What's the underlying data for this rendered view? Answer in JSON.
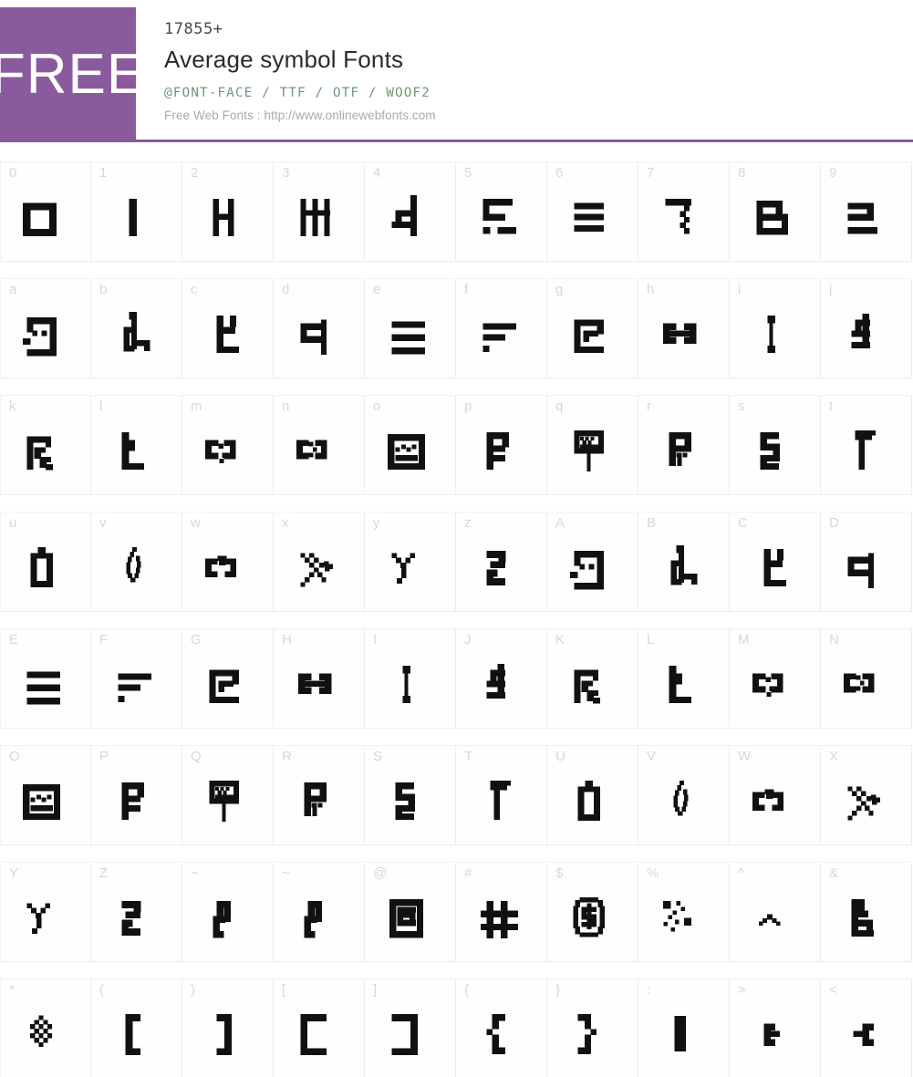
{
  "header": {
    "badge_label": "FREE",
    "count": "17855+",
    "title": "Average symbol Fonts",
    "formats": "@FONT-FACE / TTF / OTF / WOOF2",
    "source": "Free Web Fonts : http://www.onlinewebfonts.com",
    "accent_color": "#8a5a9e",
    "formats_color": "#6f9a7a"
  },
  "grid": {
    "columns": 10,
    "rows": [
      {
        "cells": [
          {
            "label": "0",
            "glyph": "square-outline"
          },
          {
            "label": "1",
            "glyph": "vertical-bar"
          },
          {
            "label": "2",
            "glyph": "h-shape"
          },
          {
            "label": "3",
            "glyph": "triple-bar-h"
          },
          {
            "label": "4",
            "glyph": "hook-right"
          },
          {
            "label": "5",
            "glyph": "s-bars"
          },
          {
            "label": "6",
            "glyph": "three-bars"
          },
          {
            "label": "7",
            "glyph": "seven-dotted"
          },
          {
            "label": "8",
            "glyph": "stacked-boxes"
          },
          {
            "label": "9",
            "glyph": "two-bar-hook"
          }
        ]
      },
      {
        "cells": [
          {
            "label": "a",
            "glyph": "face-box"
          },
          {
            "label": "b",
            "glyph": "giraffe"
          },
          {
            "label": "c",
            "glyph": "chair"
          },
          {
            "label": "d",
            "glyph": "flag-left"
          },
          {
            "label": "e",
            "glyph": "equals-three"
          },
          {
            "label": "f",
            "glyph": "two-bars-dot"
          },
          {
            "label": "g",
            "glyph": "spiral-box"
          },
          {
            "label": "h",
            "glyph": "dumbbell"
          },
          {
            "label": "i",
            "glyph": "i-bar-dots"
          },
          {
            "label": "j",
            "glyph": "flag-post"
          }
        ]
      },
      {
        "cells": [
          {
            "label": "k",
            "glyph": "stairs-flag"
          },
          {
            "label": "l",
            "glyph": "boot"
          },
          {
            "label": "m",
            "glyph": "two-boxes-v"
          },
          {
            "label": "n",
            "glyph": "two-boxes-dots"
          },
          {
            "label": "o",
            "glyph": "robot-face"
          },
          {
            "label": "p",
            "glyph": "flag-bars"
          },
          {
            "label": "q",
            "glyph": "sign-post"
          },
          {
            "label": "r",
            "glyph": "flag-drip"
          },
          {
            "label": "s",
            "glyph": "s-zigzag"
          },
          {
            "label": "t",
            "glyph": "pennant"
          }
        ]
      },
      {
        "cells": [
          {
            "label": "u",
            "glyph": "cup"
          },
          {
            "label": "v",
            "glyph": "leaf"
          },
          {
            "label": "w",
            "glyph": "two-boxes-peak"
          },
          {
            "label": "x",
            "glyph": "cross-scatter"
          },
          {
            "label": "y",
            "glyph": "y-branch"
          },
          {
            "label": "z",
            "glyph": "z-block"
          },
          {
            "label": "A",
            "glyph": "face-box"
          },
          {
            "label": "B",
            "glyph": "giraffe"
          },
          {
            "label": "C",
            "glyph": "chair"
          },
          {
            "label": "D",
            "glyph": "flag-left"
          }
        ]
      },
      {
        "cells": [
          {
            "label": "E",
            "glyph": "equals-three"
          },
          {
            "label": "F",
            "glyph": "two-bars-dot"
          },
          {
            "label": "G",
            "glyph": "spiral-box"
          },
          {
            "label": "H",
            "glyph": "dumbbell"
          },
          {
            "label": "I",
            "glyph": "i-bar-dots"
          },
          {
            "label": "J",
            "glyph": "flag-post"
          },
          {
            "label": "K",
            "glyph": "stairs-flag"
          },
          {
            "label": "L",
            "glyph": "boot"
          },
          {
            "label": "M",
            "glyph": "two-boxes-v"
          },
          {
            "label": "N",
            "glyph": "two-boxes-dots"
          }
        ]
      },
      {
        "cells": [
          {
            "label": "O",
            "glyph": "robot-face"
          },
          {
            "label": "P",
            "glyph": "flag-bars"
          },
          {
            "label": "Q",
            "glyph": "sign-post"
          },
          {
            "label": "R",
            "glyph": "flag-drip"
          },
          {
            "label": "S",
            "glyph": "s-zigzag"
          },
          {
            "label": "T",
            "glyph": "pennant"
          },
          {
            "label": "U",
            "glyph": "cup"
          },
          {
            "label": "V",
            "glyph": "leaf"
          },
          {
            "label": "W",
            "glyph": "two-boxes-peak"
          },
          {
            "label": "X",
            "glyph": "cross-scatter"
          }
        ]
      },
      {
        "cells": [
          {
            "label": "Y",
            "glyph": "y-branch"
          },
          {
            "label": "Z",
            "glyph": "z-block"
          },
          {
            "label": "~",
            "glyph": "zigzag-hook"
          },
          {
            "label": "~",
            "glyph": "zigzag-hook"
          },
          {
            "label": "@",
            "glyph": "at-box"
          },
          {
            "label": "#",
            "glyph": "hash"
          },
          {
            "label": "$",
            "glyph": "dollar-oval"
          },
          {
            "label": "%",
            "glyph": "percent-scatter"
          },
          {
            "label": "^",
            "glyph": "caret"
          },
          {
            "label": "&",
            "glyph": "amp-block"
          }
        ]
      },
      {
        "cells": [
          {
            "label": "*",
            "glyph": "asterisk-dots"
          },
          {
            "label": "(",
            "glyph": "bracket-left"
          },
          {
            "label": ")",
            "glyph": "bracket-right"
          },
          {
            "label": "[",
            "glyph": "wide-bracket-left"
          },
          {
            "label": "]",
            "glyph": "wide-bracket-right"
          },
          {
            "label": "{",
            "glyph": "brace-left"
          },
          {
            "label": "}",
            "glyph": "brace-right"
          },
          {
            "label": ":",
            "glyph": "colon-blocks"
          },
          {
            "label": ">",
            "glyph": "gt-block"
          },
          {
            "label": "<",
            "glyph": "lt-block"
          }
        ]
      }
    ]
  }
}
